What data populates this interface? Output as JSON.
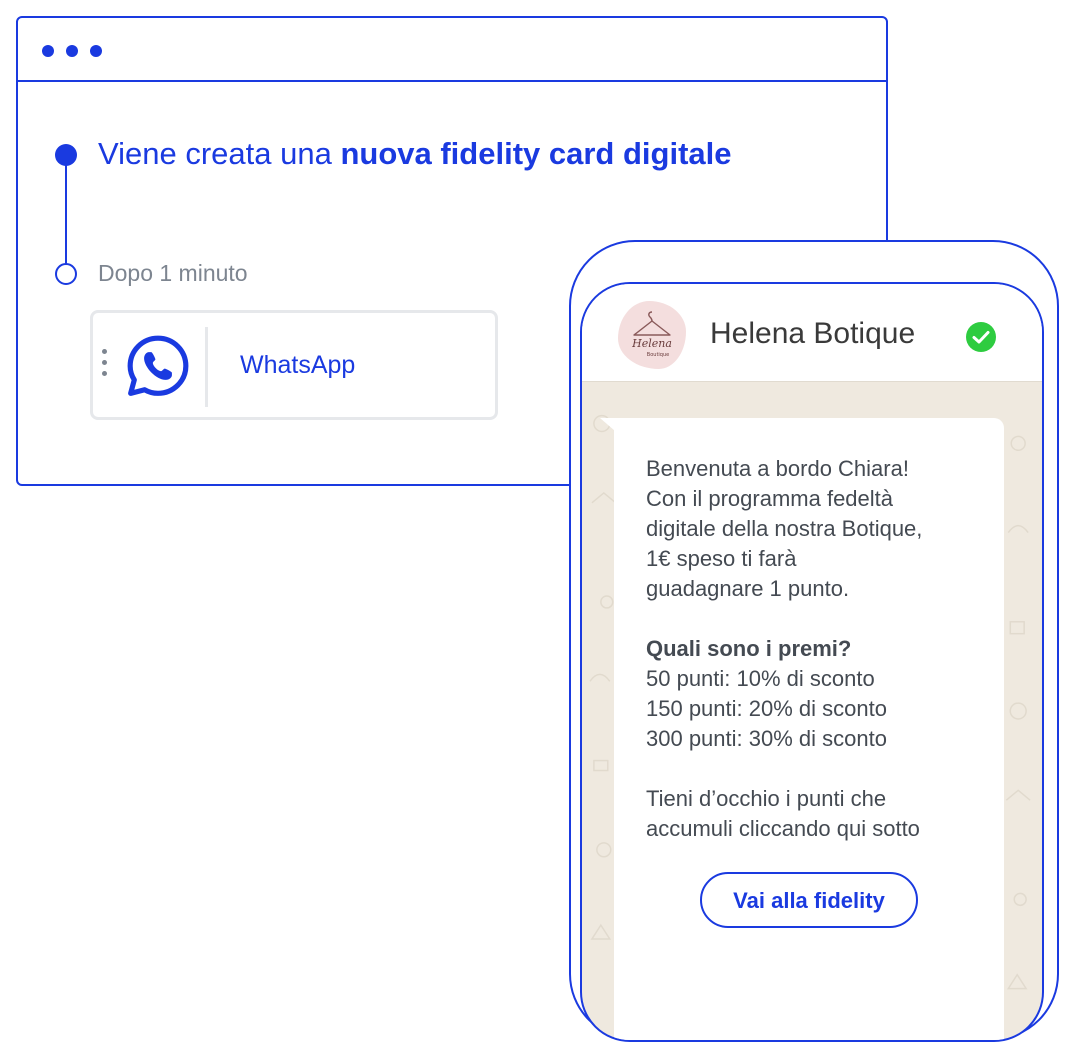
{
  "automation": {
    "step_title_regular": "Viene creata una ",
    "step_title_bold": "nuova fidelity card digitale",
    "delay_label": "Dopo 1 minuto",
    "channel": {
      "name": "WhatsApp",
      "icon": "whatsapp-icon"
    }
  },
  "phone": {
    "shop_name": "Helena Botique",
    "avatar_logo_text": [
      "Helena",
      "Boutique"
    ],
    "verified_icon": "verified-check-icon",
    "message": {
      "intro": [
        "Benvenuta a bordo Chiara!",
        "Con il programma fedeltà",
        "digitale della nostra Botique,",
        "1€ speso ti farà",
        "guadagnare 1 punto."
      ],
      "rewards_title": "Quali sono i premi?",
      "rewards": [
        "50 punti: 10% di sconto",
        "150 punti: 20% di sconto",
        "300 punti: 30% di sconto"
      ],
      "outro": [
        "Tieni d’occhio i punti che",
        "accumuli cliccando qui sotto"
      ],
      "cta_label": "Vai alla fidelity"
    }
  },
  "colors": {
    "accent": "#1a3ae0",
    "muted_text": "#7d8590",
    "chat_background": "#efe9df",
    "verified_green": "#2ecc40",
    "avatar_pink": "#f4dede"
  }
}
